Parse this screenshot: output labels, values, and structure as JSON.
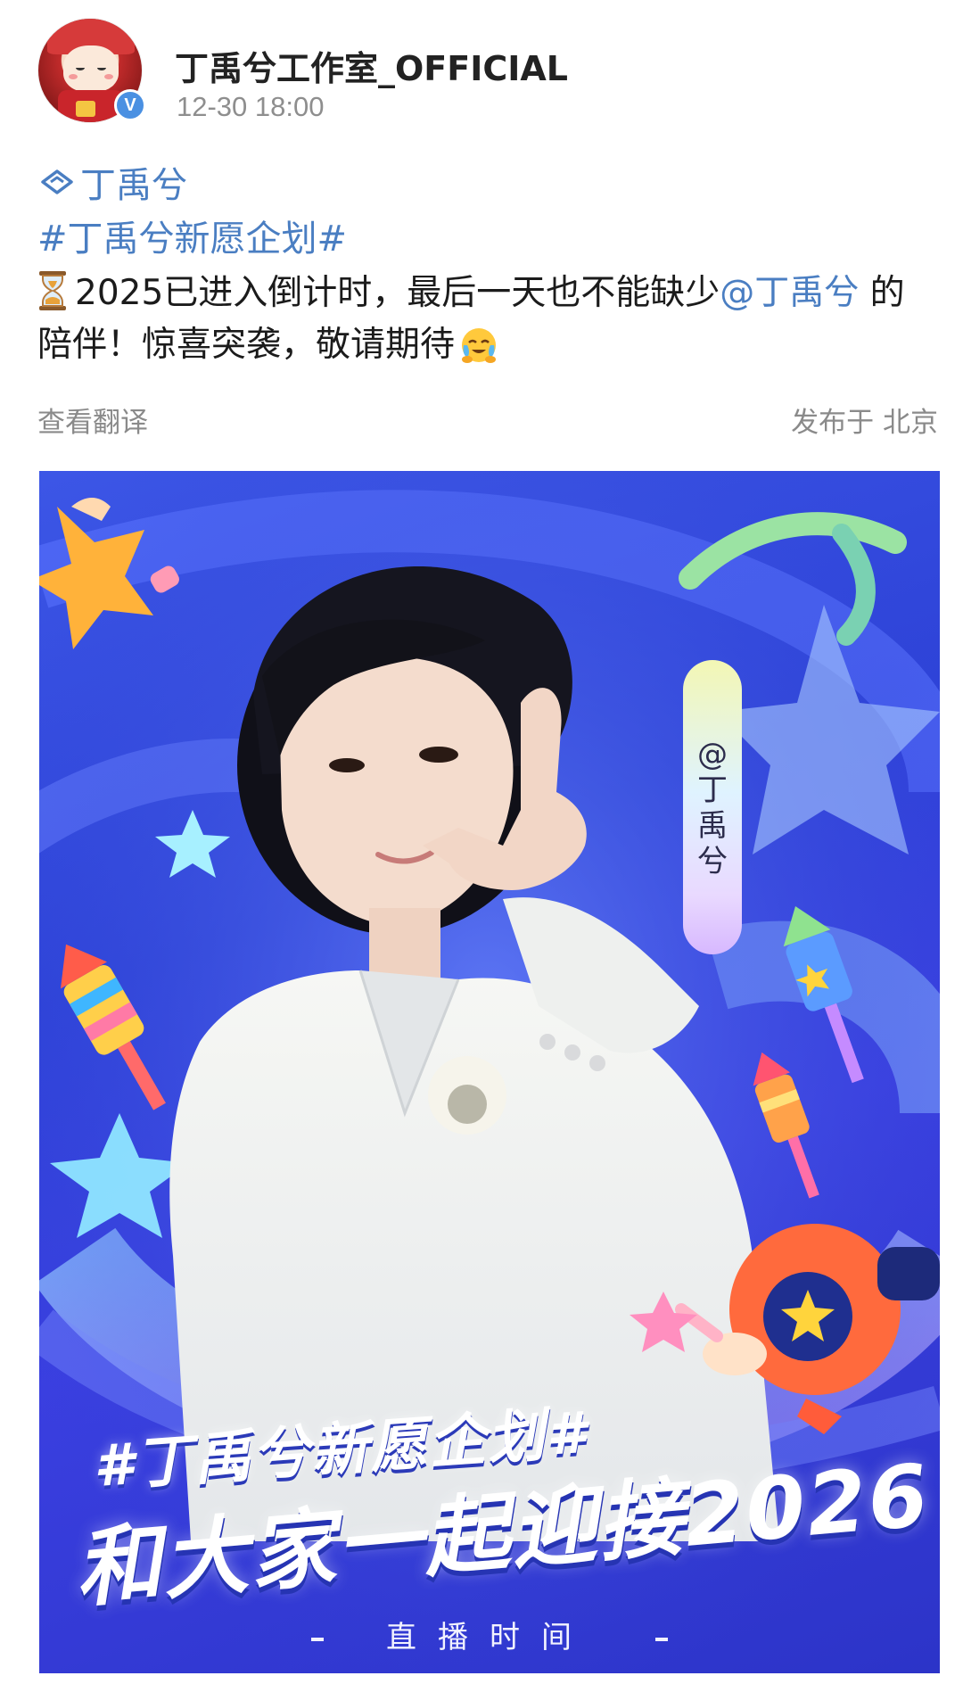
{
  "header": {
    "account_name": "丁禹兮工作室_OFFICIAL",
    "time": "12-30 18:00",
    "verified_badge": "V"
  },
  "content": {
    "super_topic": "丁禹兮",
    "hashtag": "#丁禹兮新愿企划#",
    "text_part1": "2025已进入倒计时，最后一天也不能缺少",
    "mention": "@丁禹兮",
    "text_part2": " 的陪伴！惊喜突袭，敬请期待",
    "hourglass_icon": "hourglass-icon",
    "emoji_icon": "tearful-smile-emoji"
  },
  "meta": {
    "translate": "查看翻译",
    "location": "发布于 北京"
  },
  "poster": {
    "name_tag_chars": [
      "@",
      "丁",
      "禹",
      "兮"
    ],
    "topic": "#丁禹兮新愿企划#",
    "slogan": "和大家一起迎接2026",
    "footer": "直播时间"
  },
  "colors": {
    "link": "#4a7ec2",
    "poster_bg": "#3247dc",
    "text": "#1b1b1b",
    "meta": "#8a8a8a"
  }
}
